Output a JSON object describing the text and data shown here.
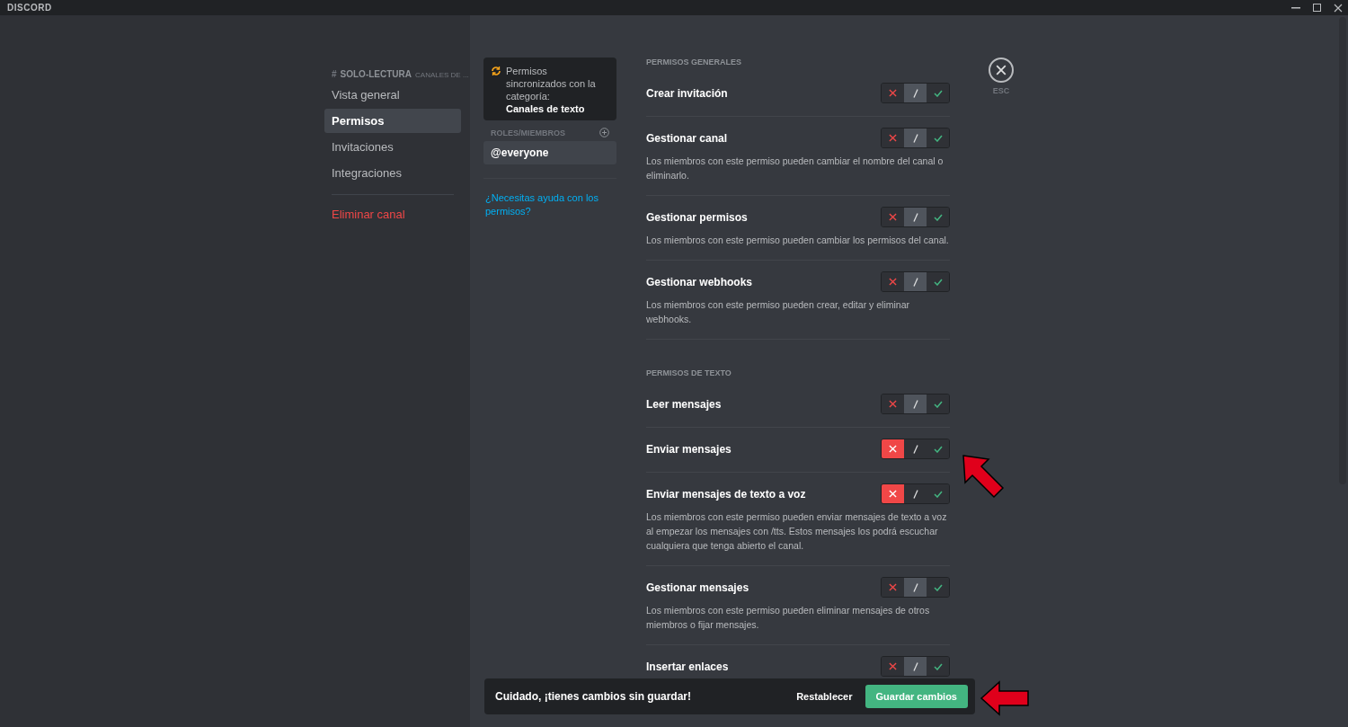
{
  "window": {
    "title": "DISCORD"
  },
  "sidebar": {
    "channel_prefix": "#",
    "channel_name": "SOLO-LECTURA",
    "channel_category": "CANALES DE ...",
    "items": [
      {
        "label": "Vista general",
        "selected": false,
        "kind": "nav"
      },
      {
        "label": "Permisos",
        "selected": true,
        "kind": "nav"
      },
      {
        "label": "Invitaciones",
        "selected": false,
        "kind": "nav"
      },
      {
        "label": "Integraciones",
        "selected": false,
        "kind": "nav"
      },
      {
        "label": "Eliminar canal",
        "selected": false,
        "kind": "danger"
      }
    ]
  },
  "roles_panel": {
    "sync_text": "Permisos sincronizados con la categoría:",
    "sync_category": "Canales de texto",
    "header": "ROLES/MIEMBROS",
    "roles": [
      {
        "label": "@everyone",
        "selected": true
      }
    ],
    "help_link": "¿Necesitas ayuda con los permisos?"
  },
  "close": {
    "label": "ESC"
  },
  "sections": [
    {
      "title": "PERMISOS GENERALES",
      "permissions": [
        {
          "name": "Crear invitación",
          "options": [
            {
              "kind": "deny",
              "selected": false
            },
            {
              "kind": "neutral",
              "selected": true
            },
            {
              "kind": "allow",
              "selected": false
            }
          ]
        },
        {
          "name": "Gestionar canal",
          "description": "Los miembros con este permiso pueden cambiar el nombre del canal o eliminarlo.",
          "options": [
            {
              "kind": "deny",
              "selected": false
            },
            {
              "kind": "neutral",
              "selected": true
            },
            {
              "kind": "allow",
              "selected": false
            }
          ]
        },
        {
          "name": "Gestionar permisos",
          "description": "Los miembros con este permiso pueden cambiar los permisos del canal.",
          "options": [
            {
              "kind": "deny",
              "selected": false
            },
            {
              "kind": "neutral",
              "selected": true
            },
            {
              "kind": "allow",
              "selected": false
            }
          ]
        },
        {
          "name": "Gestionar webhooks",
          "description": "Los miembros con este permiso pueden crear, editar y eliminar webhooks.",
          "options": [
            {
              "kind": "deny",
              "selected": false
            },
            {
              "kind": "neutral",
              "selected": true
            },
            {
              "kind": "allow",
              "selected": false
            }
          ]
        }
      ]
    },
    {
      "title": "PERMISOS DE TEXTO",
      "permissions": [
        {
          "name": "Leer mensajes",
          "options": [
            {
              "kind": "deny",
              "selected": false
            },
            {
              "kind": "neutral",
              "selected": true
            },
            {
              "kind": "allow",
              "selected": false
            }
          ]
        },
        {
          "name": "Enviar mensajes",
          "options": [
            {
              "kind": "deny",
              "selected": true
            },
            {
              "kind": "neutral",
              "selected": false
            },
            {
              "kind": "allow",
              "selected": false
            }
          ]
        },
        {
          "name": "Enviar mensajes de texto a voz",
          "description": "Los miembros con este permiso pueden enviar mensajes de texto a voz al empezar los mensajes con /tts. Estos mensajes los podrá escuchar cualquiera que tenga abierto el canal.",
          "options": [
            {
              "kind": "deny",
              "selected": true
            },
            {
              "kind": "neutral",
              "selected": false
            },
            {
              "kind": "allow",
              "selected": false
            }
          ]
        },
        {
          "name": "Gestionar mensajes",
          "description": "Los miembros con este permiso pueden eliminar mensajes de otros miembros o fijar mensajes.",
          "options": [
            {
              "kind": "deny",
              "selected": false
            },
            {
              "kind": "neutral",
              "selected": true
            },
            {
              "kind": "allow",
              "selected": false
            }
          ]
        },
        {
          "name": "Insertar enlaces",
          "options": [
            {
              "kind": "deny",
              "selected": false
            },
            {
              "kind": "neutral",
              "selected": true
            },
            {
              "kind": "allow",
              "selected": false
            }
          ]
        }
      ]
    }
  ],
  "notice": {
    "message": "Cuidado, ¡tienes cambios sin guardar!",
    "reset": "Restablecer",
    "save": "Guardar cambios"
  }
}
